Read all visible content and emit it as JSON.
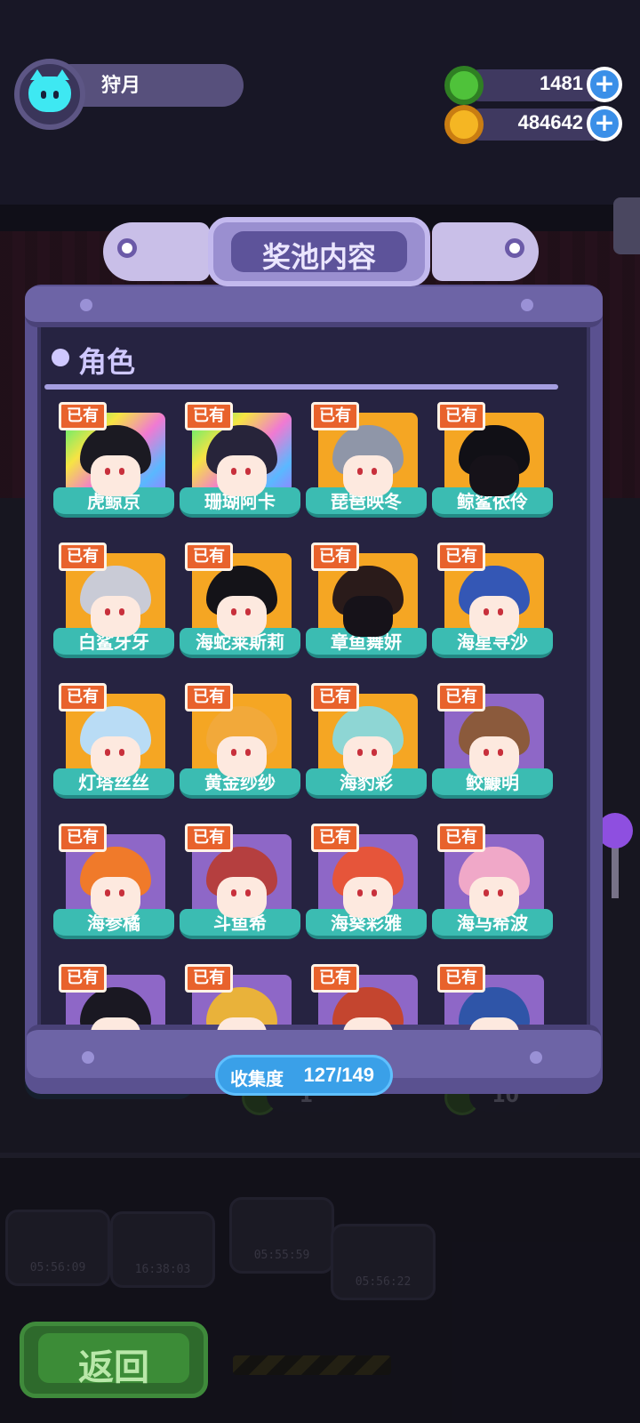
{
  "profile": {
    "name": "狩月"
  },
  "currency": [
    {
      "icon": "green-ring-coin-icon",
      "value": "1481",
      "color": "#4fc23a"
    },
    {
      "icon": "gold-planet-coin-icon",
      "value": "484642",
      "color": "#f5b623"
    }
  ],
  "modal": {
    "title": "奖池内容",
    "section_title": "角色",
    "owned_label": "已有",
    "collection": {
      "label": "收集度",
      "value": "127/149"
    }
  },
  "characters": [
    {
      "name": "虎鲸京",
      "bg": "rainbow",
      "hair": "#1b1a22",
      "silhouette": false
    },
    {
      "name": "珊瑚阿卡",
      "bg": "rainbow",
      "hair": "#27243a",
      "silhouette": false
    },
    {
      "name": "琵琶映冬",
      "bg": "gold",
      "hair": "#8f96a8",
      "silhouette": false
    },
    {
      "name": "鲸鲨依伶",
      "bg": "gold",
      "hair": "#111016",
      "silhouette": true
    },
    {
      "name": "白鲨牙牙",
      "bg": "gold",
      "hair": "#c9cbd6",
      "silhouette": false
    },
    {
      "name": "海蛇莱斯莉",
      "bg": "gold",
      "hair": "#141318",
      "silhouette": false
    },
    {
      "name": "章鱼舞妍",
      "bg": "gold",
      "hair": "#2a1b1a",
      "silhouette": true
    },
    {
      "name": "海星寻沙",
      "bg": "gold",
      "hair": "#3457b5",
      "silhouette": false
    },
    {
      "name": "灯塔丝丝",
      "bg": "gold",
      "hair": "#b9dcf5",
      "silhouette": false
    },
    {
      "name": "黄金纱纱",
      "bg": "gold",
      "hair": "#f2a93a",
      "silhouette": false
    },
    {
      "name": "海豹彩",
      "bg": "gold",
      "hair": "#8ed6d4",
      "silhouette": false
    },
    {
      "name": "鲛鱇明",
      "bg": "purple",
      "hair": "#8b5a3c",
      "silhouette": false
    },
    {
      "name": "海参橘",
      "bg": "purple",
      "hair": "#f07a2a",
      "silhouette": false
    },
    {
      "name": "斗鱼希",
      "bg": "purple",
      "hair": "#b53f3f",
      "silhouette": false
    },
    {
      "name": "海葵彩雅",
      "bg": "purple",
      "hair": "#e6553a",
      "silhouette": false
    },
    {
      "name": "海马希波",
      "bg": "purple",
      "hair": "#f0a8c8",
      "silhouette": false
    },
    {
      "name": "",
      "bg": "purple",
      "hair": "#1a1822",
      "silhouette": false
    },
    {
      "name": "",
      "bg": "purple",
      "hair": "#e9b23a",
      "silhouette": false
    },
    {
      "name": "",
      "bg": "purple",
      "hair": "#c4452f",
      "silhouette": false
    },
    {
      "name": "",
      "bg": "purple",
      "hair": "#2f55a8",
      "silhouette": false
    }
  ],
  "buttons": {
    "back": "返回"
  },
  "background": {
    "counter_left": "1",
    "counter_right": "10",
    "timers": [
      "05:56:09",
      "16:38:03",
      "05:55:59",
      "05:56:22"
    ]
  }
}
